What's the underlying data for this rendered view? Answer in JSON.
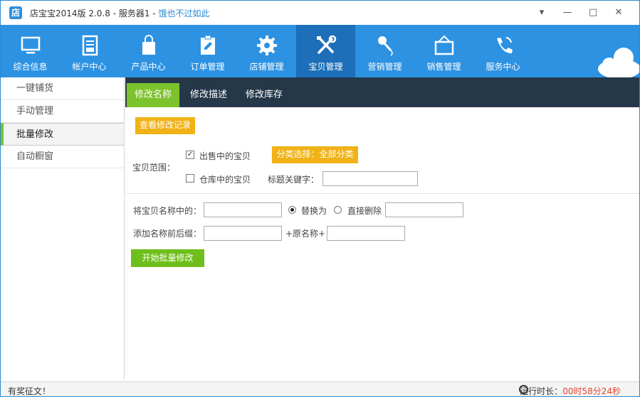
{
  "window": {
    "title_prefix": "店宝宝2014版 2.0.8 - 服务器1 - ",
    "title_link": "饿也不过如此",
    "logo_char": "店"
  },
  "nav": {
    "items": [
      {
        "label": "综合信息",
        "icon": "monitor-icon"
      },
      {
        "label": "帐户中心",
        "icon": "ledger-icon"
      },
      {
        "label": "产品中心",
        "icon": "bag-icon"
      },
      {
        "label": "订单管理",
        "icon": "clipboard-icon"
      },
      {
        "label": "店铺管理",
        "icon": "gear-icon"
      },
      {
        "label": "宝贝管理",
        "icon": "tools-icon"
      },
      {
        "label": "营销管理",
        "icon": "microphone-icon"
      },
      {
        "label": "销售管理",
        "icon": "signboard-icon"
      },
      {
        "label": "服务中心",
        "icon": "phone-icon"
      }
    ],
    "active_index": 5
  },
  "sidebar": {
    "items": [
      {
        "label": "一键铺货"
      },
      {
        "label": "手动管理"
      },
      {
        "label": "批量修改"
      },
      {
        "label": "自动橱窗"
      }
    ],
    "active_index": 2
  },
  "subtabs": [
    {
      "label": "修改名称"
    },
    {
      "label": "修改描述"
    },
    {
      "label": "修改库存"
    }
  ],
  "form": {
    "view_history_button": "查看修改记录",
    "scope_label": "宝贝范围：",
    "on_sale_label": "出售中的宝贝",
    "on_sale_checked": true,
    "category_button": "分类选择：全部分类",
    "in_stock_label": "仓库中的宝贝",
    "in_stock_checked": false,
    "title_keyword_label": "标题关键字：",
    "title_keyword_value": "",
    "replace_from_label": "将宝贝名称中的：",
    "replace_from_value": "",
    "replace_option": "替换为",
    "delete_option": "直接删除",
    "replace_to_value": "",
    "prefix_label": "添加名称前后缀：",
    "prefix_value": "",
    "original_name_label": "+原名称+",
    "suffix_value": "",
    "start_button": "开始批量修改"
  },
  "status": {
    "left": "有奖征文！",
    "runtime_label": "运行时长：",
    "runtime_value": "00时58分24秒"
  },
  "colors": {
    "nav_bg": "#2d92e2",
    "nav_active": "#1c6fb8",
    "accent_green": "#7cc22c",
    "accent_orange": "#f0b216",
    "subtab_bg": "#25384a"
  }
}
